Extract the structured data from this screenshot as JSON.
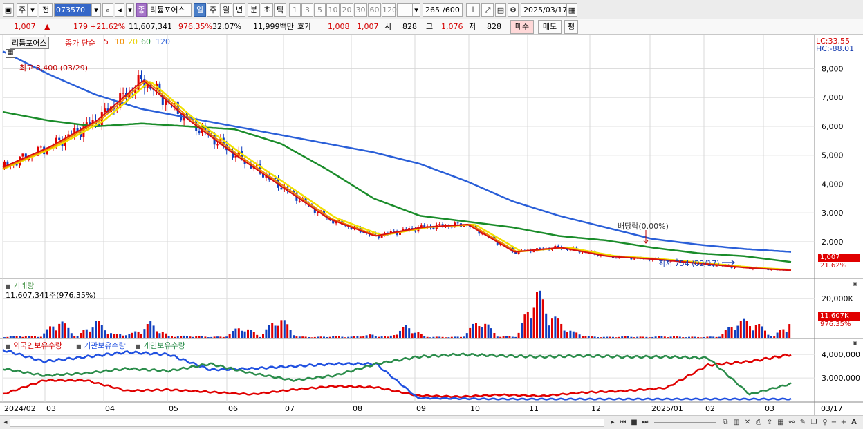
{
  "toolbar": {
    "market_label": "주",
    "prev_label": "전",
    "stock_code": "073570",
    "stock_name": "리튬포어스",
    "stock_badge": "종",
    "period_tabs": [
      "일",
      "주",
      "월",
      "년",
      "분",
      "초",
      "틱"
    ],
    "active_period": "일",
    "intervals": [
      "1",
      "3",
      "5",
      "10",
      "20",
      "30",
      "60",
      "120"
    ],
    "count_value": "265",
    "count_max": "/600",
    "date_value": "2025/03/17"
  },
  "quote": {
    "price": "1,007",
    "up_arrow": "▲",
    "change": "179",
    "change_pct": "+21.62%",
    "volume": "11,607,341",
    "volume_ratio": "976.35%",
    "turnover": "32.07%",
    "amount": "11,999백만",
    "bid_label": "호가",
    "bid_value": "1,008",
    "bid2_value": "1,007",
    "open_label": "시",
    "open_value": "828",
    "high_label": "고",
    "high_value": "1,076",
    "low_label": "저",
    "low_value": "828",
    "buy_label": "매수",
    "sell_label": "매도",
    "eval_label": "평"
  },
  "price_panel": {
    "title": "리튬포어스",
    "ma_label": "종가 단순",
    "ma_periods": [
      "5",
      "10",
      "20",
      "60",
      "120"
    ],
    "lc_text": "LC:33.55",
    "hc_text": "HC:-88.01",
    "high_annotation": "최고 8,400 (03/29)",
    "low_annotation": "최저 754 (02/17)",
    "dividend_annotation": "배당락(0.00%)",
    "current_price_tag": "1,007",
    "current_pct_tag": "21.62%"
  },
  "volume_panel": {
    "title": "거래량",
    "summary": "11,607,341주(976.35%)",
    "current_tag": "11,607K",
    "current_pct_tag": "976.35%"
  },
  "holdings_panel": {
    "series_labels": [
      "외국인보유수량",
      "기관보유수량",
      "개인보유수량"
    ]
  },
  "x_labels": [
    "2024/02",
    "03",
    "04",
    "05",
    "06",
    "07",
    "08",
    "09",
    "10",
    "11",
    "12",
    "2025/01",
    "02",
    "03",
    "03/17"
  ],
  "colors": {
    "up": "#e00000",
    "down": "#1040c0",
    "ma5": "#d81010",
    "ma10": "#f08c00",
    "ma20": "#f0e000",
    "ma60": "#1a8c2a",
    "ma120": "#2a5fd8",
    "foreign": "#e00000",
    "institution": "#2050e0",
    "individual": "#2a8c4a"
  },
  "chart_data": [
    {
      "type": "line",
      "title": "리튬포어스",
      "chart_kind": "candlestick with moving averages",
      "x": [
        "2024/02",
        "03",
        "04",
        "05",
        "06",
        "07",
        "08",
        "09",
        "10",
        "11",
        "12",
        "2025/01",
        "02",
        "03",
        "03/17"
      ],
      "y_ticks": [
        2000,
        3000,
        4000,
        5000,
        6000,
        7000,
        8000
      ],
      "ylim": [
        754,
        8800
      ],
      "series": [
        {
          "name": "종가",
          "values": [
            4600,
            5300,
            6200,
            7600,
            6200,
            5000,
            3900,
            2800,
            2200,
            2500,
            2600,
            1650,
            1800,
            1500,
            1400,
            1250,
            1100,
            1007
          ]
        },
        {
          "name": "120",
          "values": [
            8600,
            7800,
            7100,
            6600,
            6300,
            6000,
            5700,
            5400,
            5100,
            4700,
            4100,
            3400,
            2900,
            2500,
            2100,
            1900,
            1750,
            1650
          ]
        },
        {
          "name": "60",
          "values": [
            6500,
            6200,
            6000,
            6100,
            6000,
            5900,
            5400,
            4500,
            3500,
            2900,
            2700,
            2500,
            2200,
            2050,
            1800,
            1600,
            1500,
            1300
          ]
        }
      ],
      "annotations": [
        "최고 8,400 (03/29)",
        "최저 754 (02/17)",
        "배당락(0.00%)"
      ]
    },
    {
      "type": "bar",
      "title": "거래량",
      "y_ticks": [
        "20,000K"
      ],
      "ylim": [
        0,
        25000
      ],
      "values": [
        600,
        1200,
        700,
        11000,
        800,
        10000,
        2000,
        2500,
        8500,
        1000,
        1100,
        700,
        600,
        7000,
        900,
        13000,
        700,
        500,
        900,
        600,
        1800,
        500,
        7000,
        700,
        500,
        600,
        11500,
        700,
        900,
        28000,
        12000,
        3500,
        700,
        500,
        800,
        500,
        900,
        600,
        500,
        700,
        10000,
        9000,
        500,
        11607
      ]
    },
    {
      "type": "line",
      "title": "보유수량",
      "y_ticks": [
        3000000,
        4000000
      ],
      "series": [
        {
          "name": "외국인보유수량",
          "values": [
            2300000,
            2900000,
            2900000,
            2450000,
            2500000,
            2400000,
            2300000,
            2500000,
            2650000,
            2600000,
            2250000,
            2200000,
            2280000,
            2230000,
            2380000,
            2450000,
            2580000,
            3550000,
            3700000,
            4000000
          ]
        },
        {
          "name": "기관보유수량",
          "values": [
            4200000,
            3700000,
            3900000,
            4100000,
            4000000,
            3350000,
            3400000,
            3500000,
            3600000,
            3600000,
            2150000,
            2120000,
            2100000,
            2100000,
            2100000,
            2100000,
            2100000,
            2100000,
            2100000,
            2100000
          ]
        },
        {
          "name": "개인보유수량",
          "values": [
            3400000,
            3100000,
            3200000,
            3400000,
            3300000,
            3600000,
            3200000,
            2900000,
            3100000,
            3600000,
            3900000,
            4000000,
            3950000,
            3900000,
            3950000,
            3900000,
            3900000,
            3850000,
            2300000,
            2750000
          ]
        }
      ]
    }
  ]
}
